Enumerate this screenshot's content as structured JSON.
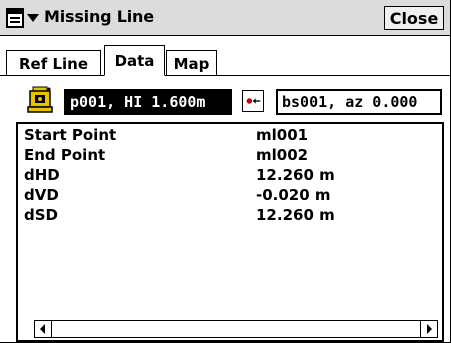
{
  "window": {
    "title": "Missing Line",
    "close_label": "Close"
  },
  "tabs": [
    {
      "label": "Ref Line",
      "active": false
    },
    {
      "label": "Data",
      "active": true
    },
    {
      "label": "Map",
      "active": false
    }
  ],
  "station": {
    "occupation": "p001, HI 1.600m",
    "backsight": "bs001, az 0.000"
  },
  "data_rows": [
    {
      "label": "Start Point",
      "value": "ml001"
    },
    {
      "label": "End Point",
      "value": "ml002"
    },
    {
      "label": "dHD",
      "value": "12.260 m"
    },
    {
      "label": "dVD",
      "value": "-0.020 m"
    },
    {
      "label": "dSD",
      "value": "12.260 m"
    }
  ],
  "icons": {
    "menu": "start-menu-icon",
    "dropdown": "triangle-down-icon",
    "station": "total-station-icon",
    "backsight": "backsight-target-icon",
    "scroll_left": "arrow-left-icon",
    "scroll_right": "arrow-right-icon"
  }
}
